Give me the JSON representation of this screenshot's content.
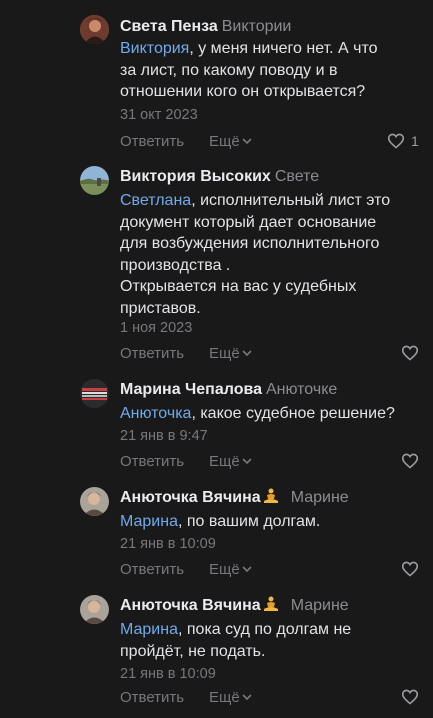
{
  "comments": [
    {
      "author": "Света Пенза",
      "reply_to": "Виктории",
      "mention": "Виктория",
      "lines": [
        ", у меня ничего нет. А что",
        "за лист, по какому поводу и в",
        "отношении кого он открывается?"
      ],
      "date": "31 окт 2023",
      "reply_label": "Ответить",
      "more_label": "Ещё",
      "likes": "1",
      "avatar": "user-photo"
    },
    {
      "author": "Виктория Высоких",
      "reply_to": "Свете",
      "mention": "Светлана",
      "lines": [
        ", исполнительный лист это",
        "документ который дает основание",
        "для возбуждения исполнительного",
        "производства .",
        "Открывается на вас у судебных",
        "приставов."
      ],
      "date": "1 ноя 2023",
      "reply_label": "Ответить",
      "more_label": "Ещё",
      "likes": "",
      "avatar": "landscape-photo"
    },
    {
      "author": "Марина Чепалова",
      "reply_to": "Анюточке",
      "mention": "Анюточка",
      "lines": [
        ", какое судебное решение?"
      ],
      "date": "21 янв в 9:47",
      "reply_label": "Ответить",
      "more_label": "Ещё",
      "likes": "",
      "avatar": "banner-image"
    },
    {
      "author": "Анюточка Вячина",
      "reply_to": "Марине",
      "mention": "Марина",
      "lines": [
        ", по вашим долгам."
      ],
      "date": "21 янв в 10:09",
      "reply_label": "Ответить",
      "more_label": "Ещё",
      "likes": "",
      "avatar": "user-photo",
      "emoji": "meditation-emoji"
    },
    {
      "author": "Анюточка Вячина",
      "reply_to": "Марине",
      "mention": "Марина",
      "lines": [
        ", пока суд по долгам не",
        "пройдёт, не подать."
      ],
      "date": "21 янв в 10:09",
      "reply_label": "Ответить",
      "more_label": "Ещё",
      "likes": "",
      "avatar": "user-photo",
      "emoji": "meditation-emoji"
    }
  ],
  "icons": {
    "like": "heart-icon",
    "more": "chevron-down-icon"
  },
  "colors": {
    "background": "#19191a",
    "mention": "#71aaeb",
    "secondary": "#76787d",
    "text": "#e2e3e6"
  }
}
